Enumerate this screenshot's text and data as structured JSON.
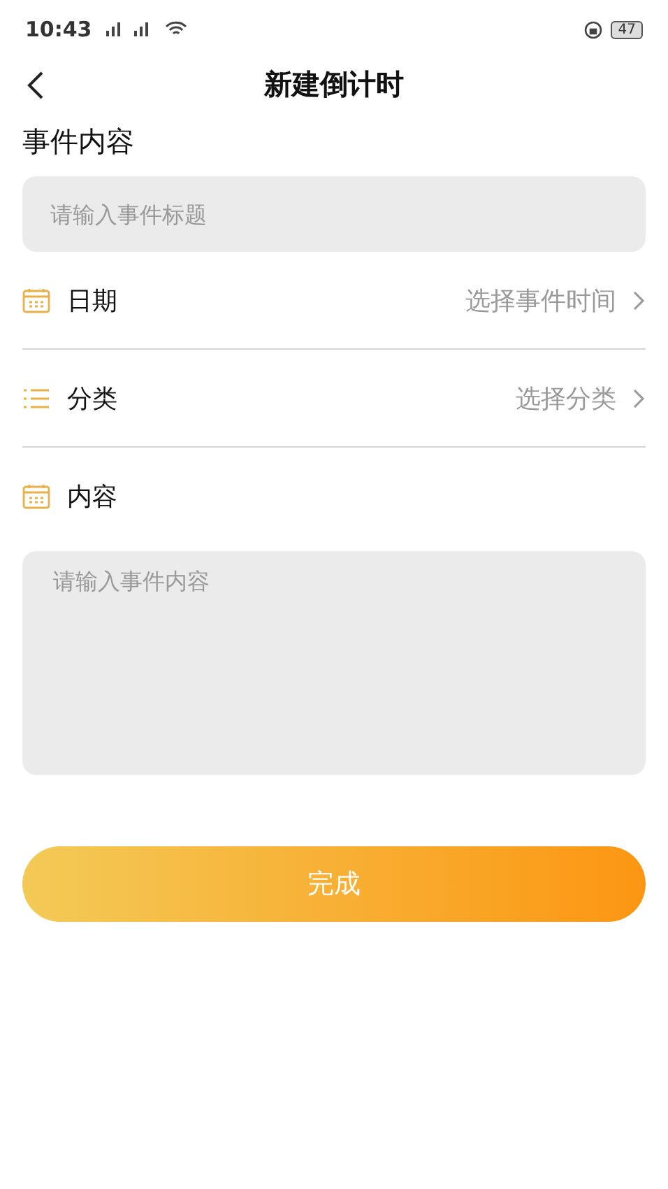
{
  "status_bar": {
    "time": "10:43",
    "battery": "47"
  },
  "nav": {
    "title": "新建倒计时"
  },
  "title_section": {
    "label": "事件内容",
    "placeholder": "请输入事件标题"
  },
  "rows": [
    {
      "kind": "date",
      "label": "日期",
      "value": "选择事件时间"
    },
    {
      "kind": "category",
      "label": "分类",
      "value": "选择分类"
    },
    {
      "kind": "content",
      "label": "内容"
    }
  ],
  "content_field": {
    "placeholder": "请输入事件内容"
  },
  "submit": {
    "label": "完成"
  }
}
